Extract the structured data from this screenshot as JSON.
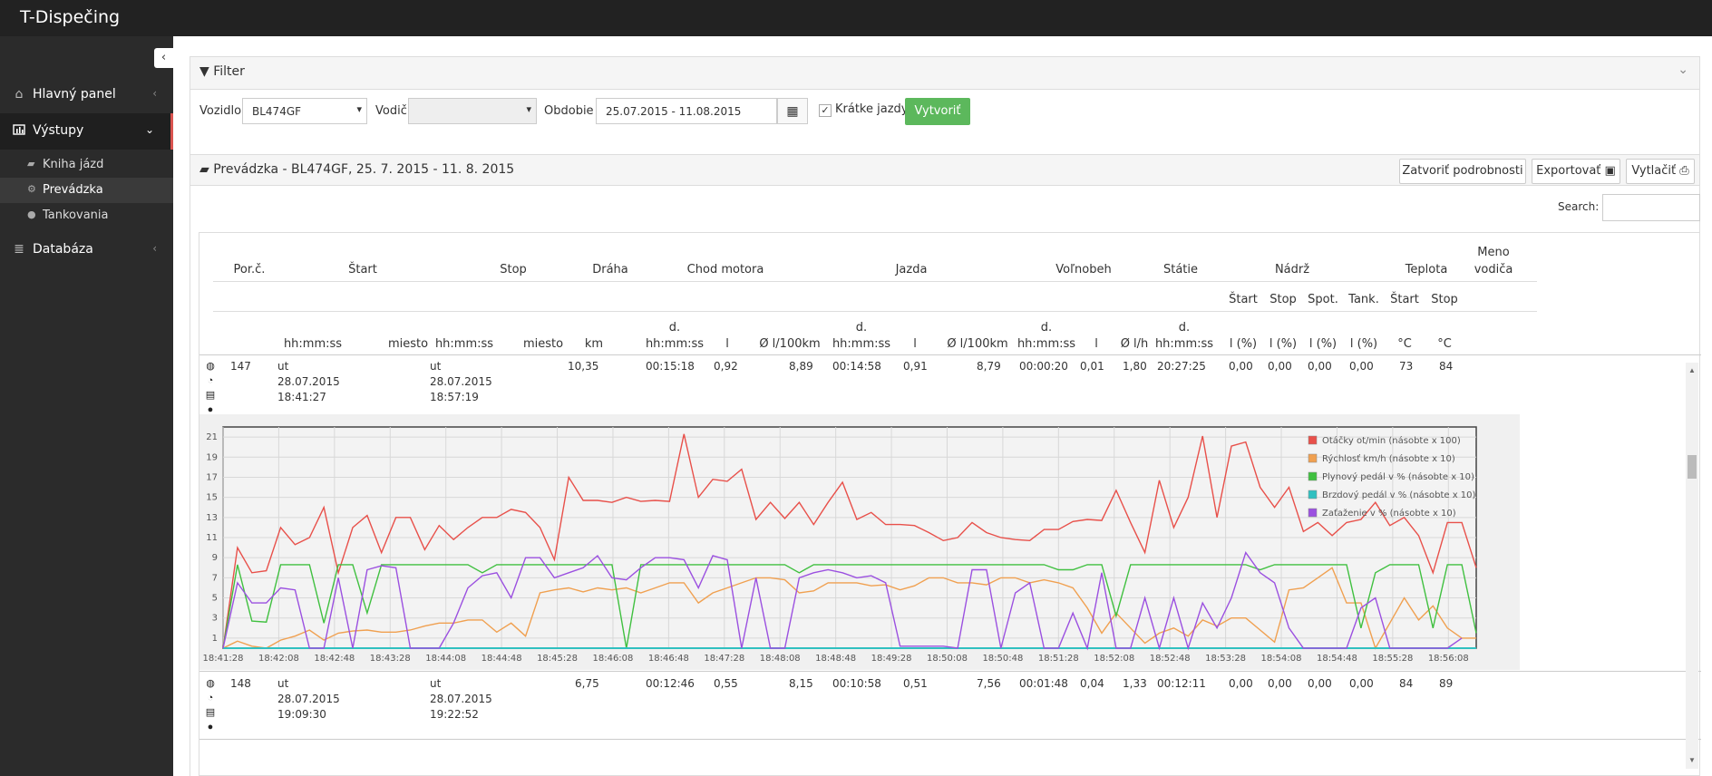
{
  "app": {
    "title": "T-Dispečing"
  },
  "sidebar": {
    "collapse_icon": "chevron-left-icon",
    "items": [
      {
        "label": "Hlavný panel",
        "icon": "home-icon"
      },
      {
        "label": "Výstupy",
        "icon": "bar-chart-icon"
      },
      {
        "label": "Databáza",
        "icon": "database-icon"
      }
    ],
    "subitems": [
      {
        "label": "Kniha jázd",
        "icon": "book-icon"
      },
      {
        "label": "Prevádzka",
        "icon": "gears-icon"
      },
      {
        "label": "Tankovania",
        "icon": "circle-icon"
      }
    ]
  },
  "filter": {
    "title": "Filter",
    "vehicle_label": "Vozidlo",
    "vehicle_value": "BL474GF",
    "driver_label": "Vodič",
    "driver_value": "",
    "period_label": "Obdobie",
    "period_value": "25.07.2015 - 11.08.2015",
    "short_trips_label": "Krátke jazdy",
    "short_trips_checked": true,
    "create_label": "Vytvoriť"
  },
  "report": {
    "title": "Prevádzka - BL474GF, 25. 7. 2015 - 11. 8. 2015",
    "close_details_label": "Zatvoriť podrobnosti",
    "export_label": "Exportovať",
    "print_label": "Vytlačiť",
    "search_label": "Search:",
    "search_value": ""
  },
  "table": {
    "header_groups": {
      "por": "Por.č.",
      "start": "Štart",
      "stop": "Stop",
      "draha": "Dráha",
      "chod": "Chod motora",
      "jazda": "Jazda",
      "volnobeh": "Voľnobeh",
      "statie": "Státie",
      "nadrz": "Nádrž",
      "teplota": "Teplota",
      "meno_1": "Meno",
      "meno_2": "vodiča"
    },
    "sub_headers": [
      "Štart",
      "Stop",
      "Spot.",
      "Tank.",
      "Štart",
      "Stop"
    ],
    "units": {
      "start_time": "hh:mm:ss",
      "start_place": "miesto",
      "stop_time": "hh:mm:ss",
      "stop_place": "miesto",
      "km": "km",
      "d": "d.",
      "hms": "hh:mm:ss",
      "l": "l",
      "cons": "Ø l/100km",
      "lh": "Ø l/h",
      "pct": "l (%)",
      "deg": "°C"
    },
    "rows": [
      {
        "por": "147",
        "start_day": "ut",
        "start_date": "28.07.2015",
        "start_time": "18:41:27",
        "stop_day": "ut",
        "stop_date": "28.07.2015",
        "stop_time": "18:57:19",
        "km": "10,35",
        "chod_t": "00:15:18",
        "chod_l": "0,92",
        "chod_avg": "8,89",
        "jazda_t": "00:14:58",
        "jazda_l": "0,91",
        "jazda_avg": "8,79",
        "vol_t": "00:00:20",
        "vol_l": "0,01",
        "vol_lh": "1,80",
        "stat_t": "20:27:25",
        "n_start": "0,00",
        "n_stop": "0,00",
        "n_spot": "0,00",
        "n_tank": "0,00",
        "t_start": "73",
        "t_stop": "84"
      },
      {
        "por": "148",
        "start_day": "ut",
        "start_date": "28.07.2015",
        "start_time": "19:09:30",
        "stop_day": "ut",
        "stop_date": "28.07.2015",
        "stop_time": "19:22:52",
        "km": "6,75",
        "chod_t": "00:12:46",
        "chod_l": "0,55",
        "chod_avg": "8,15",
        "jazda_t": "00:10:58",
        "jazda_l": "0,51",
        "jazda_avg": "7,56",
        "vol_t": "00:01:48",
        "vol_l": "0,04",
        "vol_lh": "1,33",
        "stat_t": "00:12:11",
        "n_start": "0,00",
        "n_stop": "0,00",
        "n_spot": "0,00",
        "n_tank": "0,00",
        "t_start": "84",
        "t_stop": "89"
      }
    ],
    "row_icons": [
      "globe-icon",
      "dashboard-icon",
      "chart-icon",
      "circle-icon"
    ]
  },
  "chart_data": {
    "type": "line",
    "ylim": [
      0,
      22
    ],
    "yticks": [
      1,
      3,
      5,
      7,
      9,
      11,
      13,
      15,
      17,
      19,
      21
    ],
    "x_tick_labels": [
      "18:41:28",
      "18:42:08",
      "18:42:48",
      "18:43:28",
      "18:44:08",
      "18:44:48",
      "18:45:28",
      "18:46:08",
      "18:46:48",
      "18:47:28",
      "18:48:08",
      "18:48:48",
      "18:49:28",
      "18:50:08",
      "18:50:48",
      "18:51:28",
      "18:52:08",
      "18:52:48",
      "18:53:28",
      "18:54:08",
      "18:54:48",
      "18:55:28",
      "18:56:08"
    ],
    "grid": true,
    "legend_position": "top-right",
    "series": [
      {
        "name": "Otáčky ot/min (násobte x 100)",
        "color": "#e8504a",
        "values": [
          0,
          10,
          7.5,
          7.7,
          12,
          10.3,
          11,
          14,
          7.5,
          12,
          13.2,
          9.5,
          13,
          13,
          9.8,
          12.2,
          10.8,
          12,
          13,
          13,
          13.8,
          13.5,
          12,
          8.8,
          17,
          14.7,
          14.7,
          14.5,
          15,
          14.6,
          14.7,
          14.6,
          21.3,
          15,
          16.8,
          16.6,
          17.8,
          12.8,
          14.5,
          12.9,
          14.5,
          12.3,
          14.5,
          16.5,
          12.8,
          13.5,
          12.3,
          12.3,
          12.2,
          11.5,
          10.7,
          11,
          12.5,
          11.5,
          11,
          10.8,
          10.7,
          11.8,
          11.8,
          12.6,
          12.8,
          12.7,
          15.7,
          12.5,
          9.5,
          16.7,
          12,
          15,
          21.1,
          13,
          20.1,
          20.5,
          16,
          14,
          16,
          11.6,
          12.5,
          11.2,
          12.5,
          12.8,
          14.5,
          12.2,
          13,
          11.2,
          7.5,
          12.5,
          12.5,
          8
        ]
      },
      {
        "name": "Rýchlosť km/h (násobte x 10)",
        "color": "#f0a050",
        "values": [
          0,
          0.7,
          0.2,
          0,
          0.8,
          1.2,
          1.8,
          0.8,
          1.5,
          1.7,
          1.8,
          1.6,
          1.6,
          1.8,
          2.2,
          2.5,
          2.5,
          2.8,
          2.8,
          1.6,
          2.5,
          1.2,
          5.5,
          5.8,
          6,
          5.6,
          6,
          5.8,
          6,
          5.5,
          6,
          6.5,
          6.5,
          4.5,
          5.5,
          6,
          6.5,
          7,
          7,
          6.8,
          5.5,
          5.7,
          6.5,
          6.5,
          6.5,
          6.2,
          6.3,
          5.8,
          6.2,
          7,
          7,
          6.5,
          6.5,
          6.3,
          7,
          7,
          6.5,
          6.8,
          6.5,
          6,
          4,
          1.5,
          3.5,
          2,
          0.5,
          1.5,
          2,
          1.2,
          2.8,
          2.2,
          3,
          3,
          1.8,
          0.6,
          5.8,
          6,
          7,
          8,
          4.5,
          4.5,
          0,
          2.5,
          5,
          2.8,
          4.2,
          2,
          1,
          1
        ]
      },
      {
        "name": "Plynový pedál v % (násobte x 10)",
        "color": "#40c040",
        "values": [
          0,
          8.3,
          2.7,
          2.6,
          8.3,
          8.3,
          8.3,
          2.5,
          8.3,
          8.3,
          3.5,
          8.3,
          8.3,
          8.3,
          8.3,
          8.3,
          8.3,
          8.3,
          7.5,
          8.3,
          8.3,
          8.3,
          8.3,
          8.3,
          8.3,
          8.3,
          8.3,
          8.3,
          0,
          8.3,
          8.3,
          8.3,
          8.3,
          8.3,
          8.3,
          8.3,
          8.3,
          8.3,
          8.3,
          8.3,
          7.5,
          8.3,
          8.3,
          8.3,
          8.3,
          8.3,
          8.3,
          8.3,
          8.3,
          8.3,
          8.3,
          8.3,
          8.3,
          8.3,
          8.3,
          8.3,
          8.3,
          8.3,
          7.8,
          7.8,
          8.3,
          8.3,
          3.2,
          8.3,
          8.3,
          8.3,
          8.3,
          8.3,
          8.3,
          8.3,
          8.3,
          8.3,
          7.8,
          8.3,
          8.3,
          8.3,
          8.3,
          8.3,
          8.3,
          2,
          7.5,
          8.3,
          8.3,
          8.3,
          2,
          8.3,
          8.3,
          1.5
        ]
      },
      {
        "name": "Brzdový pedál v % (násobte x 10)",
        "color": "#30c0c0",
        "values": [
          0,
          0,
          0,
          0,
          0,
          0,
          0,
          0,
          0,
          0,
          0,
          0,
          0,
          0,
          0,
          0,
          0,
          0,
          0,
          0,
          0,
          0,
          0,
          0,
          0,
          0,
          0,
          0,
          0,
          0,
          0,
          0,
          0,
          0,
          0,
          0,
          0,
          0,
          0,
          0,
          0,
          0,
          0,
          0,
          0,
          0,
          0,
          0,
          0,
          0,
          0,
          0,
          0,
          0,
          0,
          0,
          0,
          0,
          0,
          0,
          0,
          0,
          0,
          0,
          0,
          0,
          0,
          0,
          0,
          0,
          0,
          0,
          0,
          0,
          0,
          0,
          0,
          0,
          0,
          0,
          0,
          0,
          0,
          0,
          0,
          0,
          0,
          0
        ]
      },
      {
        "name": "Zaťaženie v % (násobte x 10)",
        "color": "#9b50e0",
        "values": [
          0,
          6.5,
          4.5,
          4.5,
          6,
          5.8,
          0,
          0,
          7,
          0,
          7.8,
          8.2,
          8,
          0,
          0,
          0,
          2.5,
          6,
          7.2,
          7.5,
          5,
          9,
          9,
          7,
          7.5,
          8,
          9.2,
          7,
          6.8,
          8,
          9,
          9,
          8.8,
          6,
          9.2,
          8.8,
          0,
          7,
          0,
          0,
          7,
          7.5,
          7.8,
          7.5,
          7,
          7.2,
          6.5,
          0.2,
          0.2,
          0.2,
          0.2,
          0,
          7.8,
          7.8,
          0,
          5.5,
          6.5,
          0,
          0,
          3.5,
          0,
          7.5,
          0,
          0,
          5,
          0,
          5,
          0,
          4.5,
          2,
          5,
          9.5,
          7.5,
          6.5,
          2,
          0,
          0,
          0,
          0,
          4,
          5,
          0,
          0,
          0,
          0,
          0,
          1
        ]
      }
    ]
  }
}
